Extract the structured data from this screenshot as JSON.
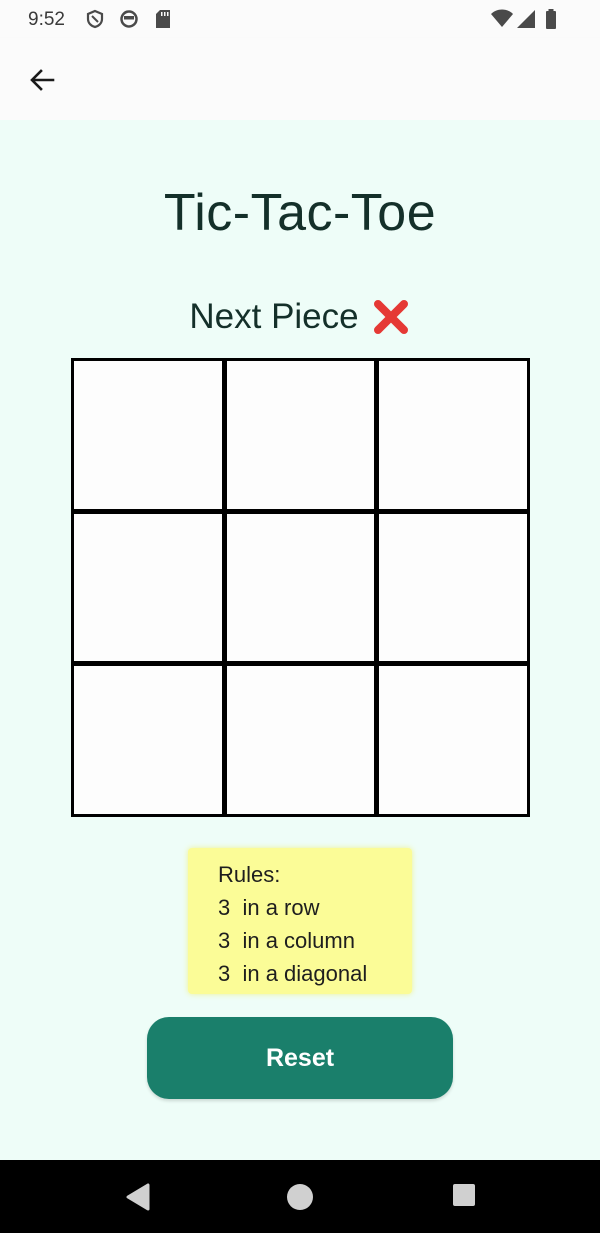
{
  "status_bar": {
    "time": "9:52",
    "icons": [
      "shield-icon",
      "vpn-circle-icon",
      "sd-card-icon",
      "wifi-icon",
      "signal-icon",
      "battery-icon"
    ]
  },
  "app_bar": {
    "back_icon": "arrow-back-icon"
  },
  "game": {
    "title": "Tic-Tac-Toe",
    "next_piece_label": "Next Piece",
    "next_piece_icon": "red-x-icon",
    "board": [
      "",
      "",
      "",
      "",
      "",
      "",
      "",
      "",
      ""
    ]
  },
  "rules": {
    "heading": "Rules:",
    "lines": [
      "3  in a row",
      "3  in a column",
      "3  in a diagonal"
    ]
  },
  "reset_label": "Reset",
  "colors": {
    "background": "#eefdf8",
    "reset_button": "#1a7f6b",
    "rules_box": "#fbfc97",
    "x_mark": "#e53935"
  },
  "nav_bar": {
    "icons": [
      "back-triangle-icon",
      "home-circle-icon",
      "recents-square-icon"
    ]
  }
}
